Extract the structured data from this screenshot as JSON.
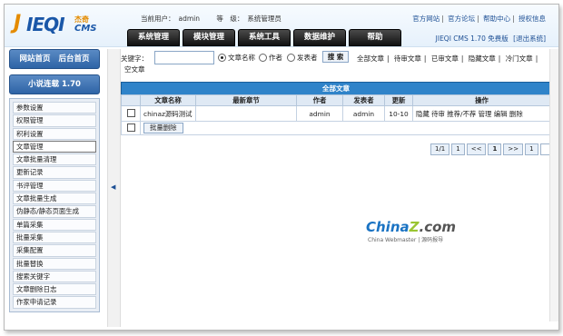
{
  "logo": {
    "j": "J",
    "ieqi": "IEQI",
    "cn": "杰奇",
    "cms": "CMS"
  },
  "header": {
    "current_user_label": "当前用户：",
    "current_user": "admin",
    "level_label": "等　级：",
    "level": "系统管理员",
    "links": [
      "官方网站",
      "官方论坛",
      "帮助中心",
      "授权信息"
    ],
    "version": "JIEQI CMS 1.70 免费版",
    "logout": "[退出系统]"
  },
  "tabs": [
    "系统管理",
    "模块管理",
    "系统工具",
    "数据维护",
    "帮助"
  ],
  "sidebar": {
    "nav_home": "网站首页",
    "nav_admin": "后台首页",
    "module_title": "小说连载 1.70",
    "items": [
      "参数设置",
      "权限管理",
      "积利设置",
      "文章管理",
      "文章批量清理",
      "更新记录",
      "书评管理",
      "文章批量生成",
      "伪静态/静态页面生成",
      "单篇采集",
      "批量采集",
      "采集配置",
      "批量替换",
      "搜索关键字",
      "文章删除日志",
      "作家申请记录"
    ],
    "active_index": 3
  },
  "filter": {
    "keyword_label": "关键字：",
    "keyword_value": "",
    "radios": [
      "文章名称",
      "作者",
      "发表者"
    ],
    "selected_radio": 0,
    "search_button": "搜 索",
    "article_links": [
      "全部文章",
      "待审文章",
      "已审文章",
      "隐藏文章",
      "冷门文章"
    ],
    "article_links_2": "空文章"
  },
  "table": {
    "title": "全部文章",
    "headers": [
      "文章名称",
      "最新章节",
      "作者",
      "发表者",
      "更新",
      "操作"
    ],
    "rows": [
      {
        "name": "chinaz源码测试",
        "latest": "",
        "author": "admin",
        "poster": "admin",
        "updated": "10-10",
        "actions": "隐藏 待审 推荐/不荐 管理 编辑 删除"
      }
    ],
    "batch_delete": "批量删除"
  },
  "pager": {
    "page_of": "1/1",
    "first": "1",
    "prev": "<<",
    "current": "1",
    "next": ">>",
    "last": "1",
    "goto_value": ""
  },
  "watermark": {
    "china": "China",
    "z": "Z",
    "com": ".com",
    "sub": "China Webmaster | 源码报导"
  },
  "colors": {
    "accent": "#2f83c9",
    "tab_bg": "#111111",
    "sidebar_btn": "#2e64a6",
    "logo_orange": "#e48b00",
    "logo_blue": "#1a57a8"
  }
}
